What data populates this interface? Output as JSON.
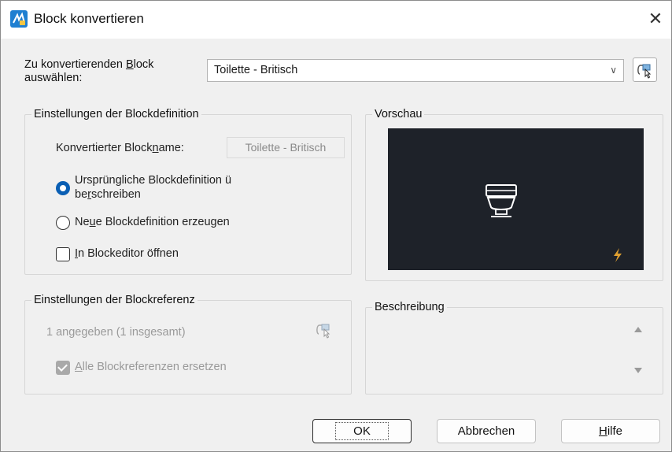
{
  "window": {
    "title": "Block konvertieren",
    "close_glyph": "✕"
  },
  "block_select": {
    "label_pre": "Zu konvertierenden ",
    "label_underlined": "B",
    "label_post": "lock",
    "label_line2": "auswählen:",
    "value": "Toilette - Britisch",
    "dropdown_icon": "chevron-down-icon",
    "pick_icon": "select-objects-icon"
  },
  "definition_group": {
    "title": "Einstellungen der Blockdefinition",
    "converted_name_label_pre": "Konvertierter Block",
    "converted_name_label_u": "n",
    "converted_name_label_post": "ame:",
    "converted_name_value": "Toilette - Britisch",
    "radio_overwrite_line1": "Ursprüngliche Blockdefinition ü",
    "radio_overwrite_line2_pre": "be",
    "radio_overwrite_line2_u": "r",
    "radio_overwrite_line2_post": "schreiben",
    "radio_overwrite_selected": true,
    "radio_new_pre": "Ne",
    "radio_new_u": "u",
    "radio_new_post": "e Blockdefinition erzeugen",
    "checkbox_editor_u": "I",
    "checkbox_editor_post": "n Blockeditor öffnen",
    "checkbox_editor_checked": false
  },
  "preview_group": {
    "title": "Vorschau",
    "background": "#1e2229",
    "block_icon": "toilet-block-icon",
    "badge_icon": "lightning-icon"
  },
  "reference_group": {
    "title": "Einstellungen der Blockreferenz",
    "count_text": "1 angegeben (1 insgesamt)",
    "pick_icon": "select-objects-icon",
    "replace_u": "A",
    "replace_post": "lle Blockreferenzen ersetzen",
    "replace_checked": true
  },
  "description_group": {
    "title": "Beschreibung",
    "text": ""
  },
  "buttons": {
    "ok": "OK",
    "cancel": "Abbrechen",
    "help_u": "H",
    "help_post": "ilfe"
  },
  "colors": {
    "accent": "#0a5fb4",
    "dialog_bg": "#f0f0f0",
    "lightning": "#e0a030"
  }
}
